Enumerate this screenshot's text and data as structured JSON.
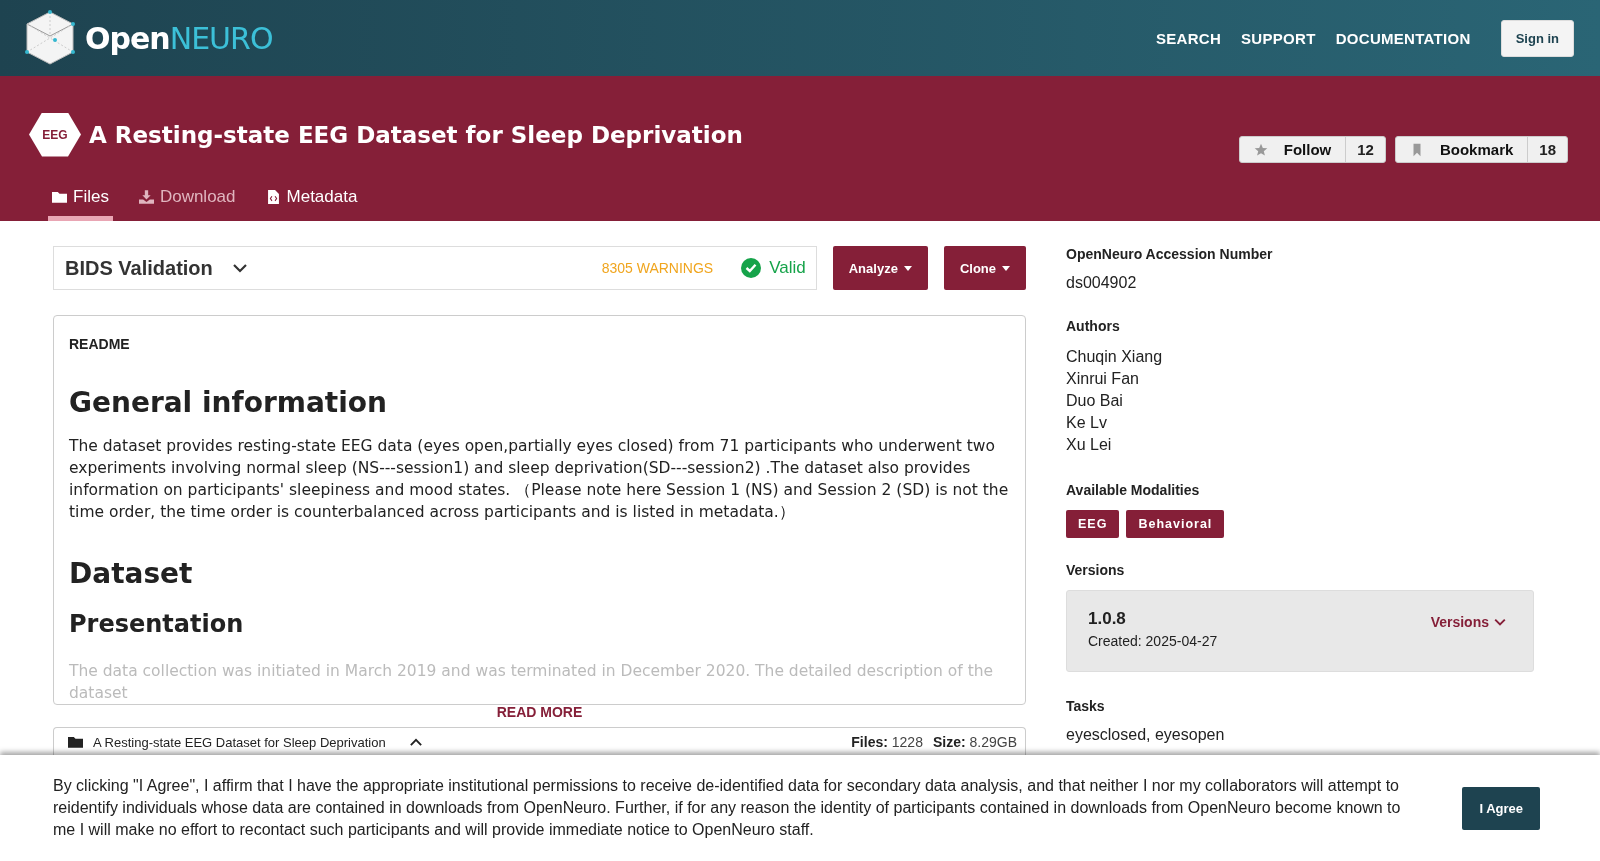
{
  "header": {
    "logo": {
      "open": "Open",
      "neuro": "NEURO"
    },
    "nav": [
      "SEARCH",
      "SUPPORT",
      "DOCUMENTATION"
    ],
    "sign_in": "Sign in"
  },
  "dataset": {
    "modality": "EEG",
    "title": "A Resting-state EEG Dataset for Sleep Deprivation",
    "follow": {
      "label": "Follow",
      "count": "12"
    },
    "bookmark": {
      "label": "Bookmark",
      "count": "18"
    },
    "tabs": [
      {
        "label": "Files",
        "kind": "folder",
        "selected": true,
        "disabled": false
      },
      {
        "label": "Download",
        "kind": "download",
        "selected": false,
        "disabled": true
      },
      {
        "label": "Metadata",
        "kind": "metadata",
        "selected": false,
        "disabled": false
      }
    ]
  },
  "validation": {
    "title": "BIDS Validation",
    "warnings": "8305 WARNINGS",
    "status": "Valid"
  },
  "actions": [
    "Analyze",
    "Clone"
  ],
  "readme": {
    "label": "README",
    "blocks": [
      {
        "kind": "h1",
        "text": "General information"
      },
      {
        "kind": "p",
        "text": "The dataset provides resting-state EEG data (eyes open,partially eyes closed) from 71 participants who underwent two experiments involving normal sleep (NS---session1) and sleep deprivation(SD---session2) .The dataset also provides information on participants' sleepiness and mood states. （Please note here Session 1 (NS) and Session 2 (SD) is not the time order, the time order is counterbalanced across participants and is listed in metadata.）"
      },
      {
        "kind": "h1",
        "text": "Dataset"
      },
      {
        "kind": "h2",
        "text": "Presentation"
      },
      {
        "kind": "faded",
        "text": "The data collection was initiated in March 2019 and was terminated in December 2020. The detailed description of the dataset"
      }
    ],
    "read_more": "READ MORE"
  },
  "file_tree": {
    "name": "A Resting-state EEG Dataset for Sleep Deprivation",
    "expanded": true,
    "files_label": "Files:",
    "files": "1228",
    "size_label": "Size:",
    "size": "8.29GB"
  },
  "sidebar": {
    "accession": {
      "heading": "OpenNeuro Accession Number",
      "value": "ds004902"
    },
    "authors": {
      "heading": "Authors",
      "names": [
        "Chuqin Xiang",
        "Xinrui Fan",
        "Duo Bai",
        "Ke Lv",
        "Xu Lei"
      ]
    },
    "modalities": {
      "heading": "Available Modalities",
      "items": [
        "EEG",
        "Behavioral"
      ]
    },
    "versions": {
      "heading": "Versions",
      "version": "1.0.8",
      "created": "Created: 2025-04-27",
      "menu": "Versions"
    },
    "tasks": {
      "heading": "Tasks",
      "value": "eyesclosed, eyesopen"
    }
  },
  "consent": {
    "text": "By clicking \"I Agree\", I affirm that I have the appropriate institutional permissions to receive de-identified data for secondary data analysis, and that neither I nor my collaborators will attempt to reidentify individuals whose data are contained in downloads from OpenNeuro. Further, if for any reason the identity of participants contained in downloads from OpenNeuro become known to me I will make no effort to recontact such participants and will provide immediate notice to OpenNeuro staff.",
    "button": "I Agree"
  }
}
